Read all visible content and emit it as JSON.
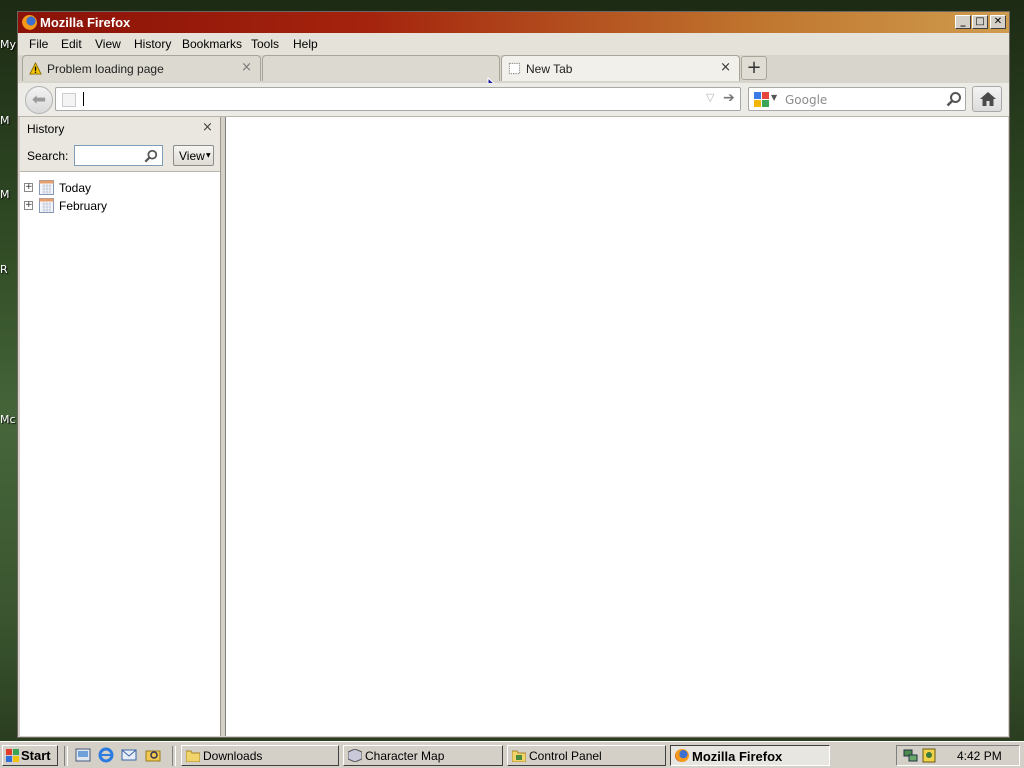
{
  "desktop": {
    "icon_labels": [
      "My",
      "M",
      "M",
      "R",
      "Mc"
    ]
  },
  "window": {
    "title": "Mozilla Firefox",
    "controls": {
      "minimize": "_",
      "maximize": "□",
      "close": "✕"
    }
  },
  "menubar": {
    "items": [
      "File",
      "Edit",
      "View",
      "History",
      "Bookmarks",
      "Tools",
      "Help"
    ]
  },
  "tabs": [
    {
      "label": "Problem loading page",
      "icon": "warning-icon",
      "state": "inactive"
    },
    {
      "label": "",
      "icon": "",
      "state": "inactive"
    },
    {
      "label": "New Tab",
      "icon": "blank-page-icon",
      "state": "active"
    }
  ],
  "new_tab_button": "+",
  "navbar": {
    "url_value": "",
    "search_placeholder": "Google"
  },
  "sidebar": {
    "title": "History",
    "search_label": "Search:",
    "search_value": "",
    "view_button": "View",
    "tree": [
      {
        "label": "Today",
        "expander": "+"
      },
      {
        "label": "February",
        "expander": "+"
      }
    ]
  },
  "taskbar": {
    "start_label": "Start",
    "tasks": [
      {
        "label": "Downloads",
        "icon": "folder-icon",
        "active": false
      },
      {
        "label": "Character Map",
        "icon": "charmap-icon",
        "active": false
      },
      {
        "label": "Control Panel",
        "icon": "control-panel-icon",
        "active": false
      },
      {
        "label": "Mozilla Firefox",
        "icon": "firefox-icon",
        "active": true
      }
    ],
    "clock": "4:42 PM"
  }
}
